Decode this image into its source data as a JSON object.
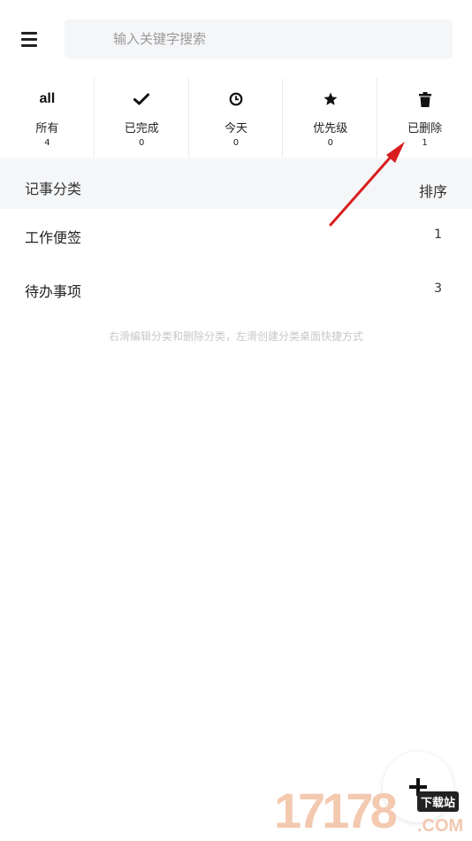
{
  "search": {
    "placeholder": "输入关键字搜索"
  },
  "filters": [
    {
      "icon": "all-text-icon",
      "icon_text": "all",
      "label": "所有",
      "count": "4"
    },
    {
      "icon": "check-icon",
      "label": "已完成",
      "count": "0"
    },
    {
      "icon": "clock-icon",
      "label": "今天",
      "count": "0"
    },
    {
      "icon": "star-icon",
      "label": "优先级",
      "count": "0"
    },
    {
      "icon": "trash-icon",
      "label": "已删除",
      "count": "1"
    }
  ],
  "section": {
    "title": "记事分类",
    "sort_label": "排序"
  },
  "categories": [
    {
      "name": "工作便签",
      "count": "1"
    },
    {
      "name": "待办事项",
      "count": "3"
    }
  ],
  "hint": "右滑编辑分类和删除分类，左滑创建分类桌面快捷方式",
  "watermark": {
    "number": "17178",
    "site": "下载站",
    "domain": ".COM"
  },
  "colors": {
    "accent_arrow": "#d81e1e",
    "section_bg": "#f5f6f8",
    "hint_text": "#c8c8c8"
  }
}
